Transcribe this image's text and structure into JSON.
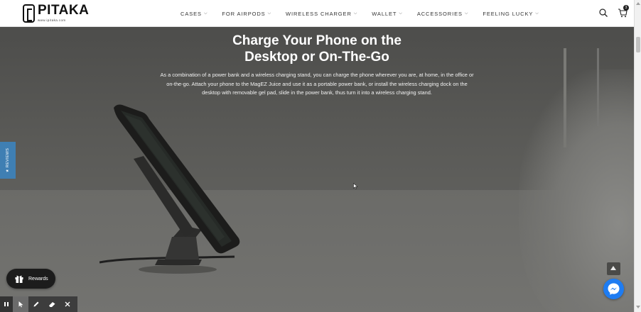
{
  "brand": {
    "name": "PITAKA",
    "url": "www.ipitaka.com"
  },
  "nav": {
    "items": [
      {
        "label": "CASES"
      },
      {
        "label": "FOR AIRPODS"
      },
      {
        "label": "WIRELESS CHARGER"
      },
      {
        "label": "WALLET"
      },
      {
        "label": "ACCESSORIES"
      },
      {
        "label": "FEELING LUCKY"
      }
    ],
    "chevron": "⌵"
  },
  "header_icons": {
    "search": "search-icon",
    "cart": "cart-icon",
    "cart_count": "3"
  },
  "hero": {
    "title_line1": "Charge Your Phone on the",
    "title_line2": "Desktop or On-The-Go",
    "description": "As a combination of a power bank and a wireless charging stand, you can charge the phone wherever you are, at home, in the office or on-the-go. Attach your phone to the MagEZ Juice and use it as a portable power bank, or install the wireless charging dock on the desktop with removable gel pad, slide in the power bank, thus turn it into a wireless charging stand."
  },
  "reviews_tab": {
    "label": "★ REVIEWS"
  },
  "rewards": {
    "label": "Rewards",
    "icon": "gift-icon"
  },
  "widgets": {
    "back_to_top": "arrow-up-icon",
    "messenger": "messenger-icon"
  },
  "toolbar": {
    "tools": [
      "pause-icon",
      "pointer-icon",
      "pen-icon",
      "eraser-icon",
      "close-icon"
    ]
  },
  "colors": {
    "header_bg": "#ffffff",
    "reviews_tab": "#3f7fb3",
    "messenger": "#1e7cf2",
    "rewards_bg": "#1c1c1c"
  }
}
